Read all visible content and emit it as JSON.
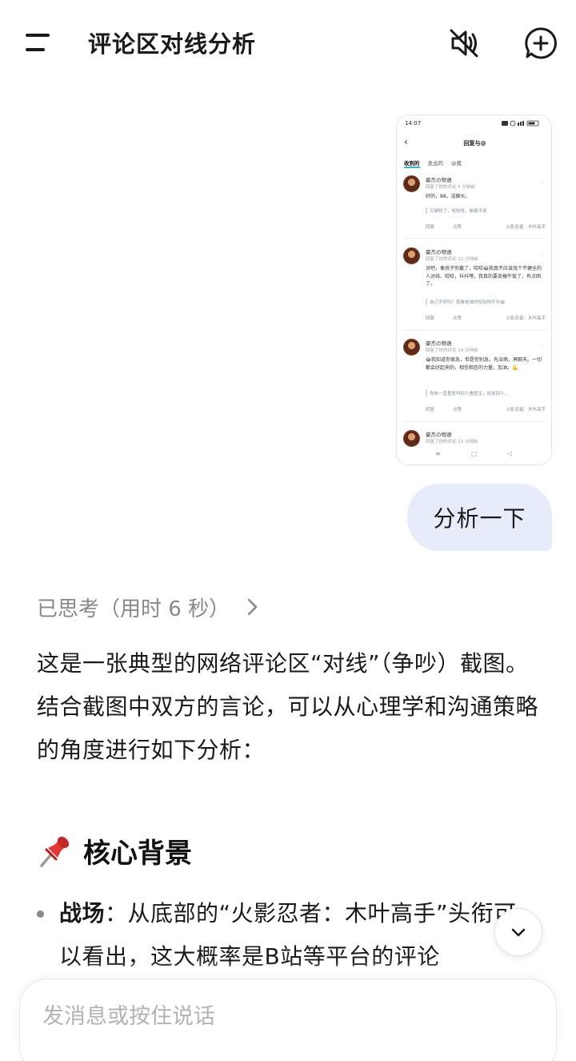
{
  "header": {
    "title": "评论区对线分析",
    "menu_icon": "menu-icon",
    "mute_icon": "speaker-muted-icon",
    "new_chat_icon": "new-chat-plus-icon"
  },
  "attachment": {
    "status_time": "14:07",
    "page_title": "回复与@",
    "tabs": [
      "收到的",
      "发出的",
      "@我"
    ],
    "comments": [
      {
        "name": "豪杰の物语",
        "meta": "回复了你的评论 5 分钟前",
        "text": "好的，88，没聊头。",
        "quote": "又破防了，哈哈哈，偷偷不说",
        "reply": "回复",
        "like": "点赞",
        "source": "火影忍者：木叶高手"
      },
      {
        "name": "豪杰の物语",
        "meta": "回复了你的评论 12 分钟前",
        "text": "对吧，像孩子你赢了，哈哈😂我真不应该找个不健全的人对线，哈哈，抖抖嘿，我真的要去搞午饭了，有点困了。",
        "quote": "自己不好吗？我看是谁的检验你开开😂",
        "reply": "回复",
        "like": "点赞",
        "source": "火影忍者：木叶高手"
      },
      {
        "name": "豪杰の物语",
        "meta": "回复了你的评论 14 分钟前",
        "text": "😂我知道你很急，但是你别急，先治病，再聊天。一切都会好起来的，相信相信的力量，加油。💪",
        "quote": "你自一直重复叫别人看医生，说说别人…",
        "reply": "回复",
        "like": "点赞",
        "source": "火影忍者：木叶高手"
      },
      {
        "name": "豪杰の物语",
        "meta": "回复了你的评论 15 分钟前"
      }
    ]
  },
  "user_message": "分析一下",
  "thinking": {
    "label": "已思考（用时 6 秒）"
  },
  "answer": {
    "intro": "这是一张典型的网络评论区“对线”（争吵）截图。结合截图中双方的言论，可以从心理学和沟通策略的角度进行如下分析：",
    "section_title": "核心背景",
    "section_icon": "pushpin-icon",
    "bullet_label": "战场",
    "bullet_text": "：从底部的“火影忍者：木叶高手”头衔可以看出，这大概率是B站等平台的评论"
  },
  "input": {
    "placeholder": "发消息或按住说话"
  },
  "colors": {
    "bubble_bg": "#e6ecfa",
    "tab_accent": "#2fb5c9",
    "muted_text": "#888888"
  }
}
